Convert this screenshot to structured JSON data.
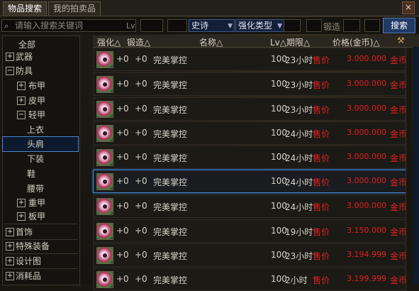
{
  "tabs": [
    {
      "label": "物品搜索"
    },
    {
      "label": "我的拍卖品"
    }
  ],
  "close_label": "×",
  "search": {
    "placeholder": "请输入搜索关键词",
    "lv_label": "Lv",
    "rarity_value": "史诗",
    "forge_type_value": "强化类型",
    "forge_label": "锻造",
    "search_button": "搜索"
  },
  "categories": [
    {
      "label": "全部",
      "toggle": ""
    },
    {
      "label": "武器",
      "toggle": "+"
    },
    {
      "label": "防具",
      "toggle": "−"
    },
    {
      "label": "布甲",
      "toggle": "+"
    },
    {
      "label": "皮甲",
      "toggle": "+"
    },
    {
      "label": "轻甲",
      "toggle": "−"
    },
    {
      "label": "上衣",
      "toggle": ""
    },
    {
      "label": "头肩",
      "toggle": ""
    },
    {
      "label": "下装",
      "toggle": ""
    },
    {
      "label": "鞋",
      "toggle": ""
    },
    {
      "label": "腰带",
      "toggle": ""
    },
    {
      "label": "重甲",
      "toggle": "+"
    },
    {
      "label": "板甲",
      "toggle": "+"
    },
    {
      "label": "首饰",
      "toggle": "+"
    },
    {
      "label": "特殊装备",
      "toggle": "+"
    },
    {
      "label": "设计图",
      "toggle": "+"
    },
    {
      "label": "消耗品",
      "toggle": "+"
    }
  ],
  "columns": {
    "enhance": "强化△",
    "forge": "锻造△",
    "name": "名称△",
    "lv_time": "Lv△期限△",
    "price": "价格(金币)△"
  },
  "rows": [
    {
      "enhance": "+0",
      "forge": "+0",
      "name": "完美掌控",
      "lv": "100",
      "time": "23小时",
      "price_label": "售价",
      "price": "3.000.000",
      "unit": "金币"
    },
    {
      "enhance": "+0",
      "forge": "+0",
      "name": "完美掌控",
      "lv": "100",
      "time": "23小时",
      "price_label": "售价",
      "price": "3.000.000",
      "unit": "金币"
    },
    {
      "enhance": "+0",
      "forge": "+0",
      "name": "完美掌控",
      "lv": "100",
      "time": "23小时",
      "price_label": "售价",
      "price": "3.000.000",
      "unit": "金币"
    },
    {
      "enhance": "+0",
      "forge": "+0",
      "name": "完美掌控",
      "lv": "100",
      "time": "24小时",
      "price_label": "售价",
      "price": "3.000.000",
      "unit": "金币"
    },
    {
      "enhance": "+0",
      "forge": "+0",
      "name": "完美掌控",
      "lv": "100",
      "time": "24小时",
      "price_label": "售价",
      "price": "3.000.000",
      "unit": "金币"
    },
    {
      "enhance": "+0",
      "forge": "+0",
      "name": "完美掌控",
      "lv": "100",
      "time": "24小时",
      "price_label": "售价",
      "price": "3.000.000",
      "unit": "金币"
    },
    {
      "enhance": "+0",
      "forge": "+0",
      "name": "完美掌控",
      "lv": "100",
      "time": "24小时",
      "price_label": "售价",
      "price": "3.000.000",
      "unit": "金币"
    },
    {
      "enhance": "+0",
      "forge": "+0",
      "name": "完美掌控",
      "lv": "100",
      "time": "19小时",
      "price_label": "售价",
      "price": "3.150.000",
      "unit": "金币"
    },
    {
      "enhance": "+0",
      "forge": "+0",
      "name": "完美掌控",
      "lv": "100",
      "time": "23小时",
      "price_label": "售价",
      "price": "3.194.999",
      "unit": "金币"
    },
    {
      "enhance": "+0",
      "forge": "+0",
      "name": "完美掌控",
      "lv": "100",
      "time": "2小时",
      "price_label": "售价",
      "price": "3.199.999",
      "unit": "金币"
    }
  ],
  "highlighted_row": 5,
  "highlighted_category": 7,
  "colors": {
    "price_red": "#e02020",
    "highlight_blue": "#3f8ad8"
  }
}
